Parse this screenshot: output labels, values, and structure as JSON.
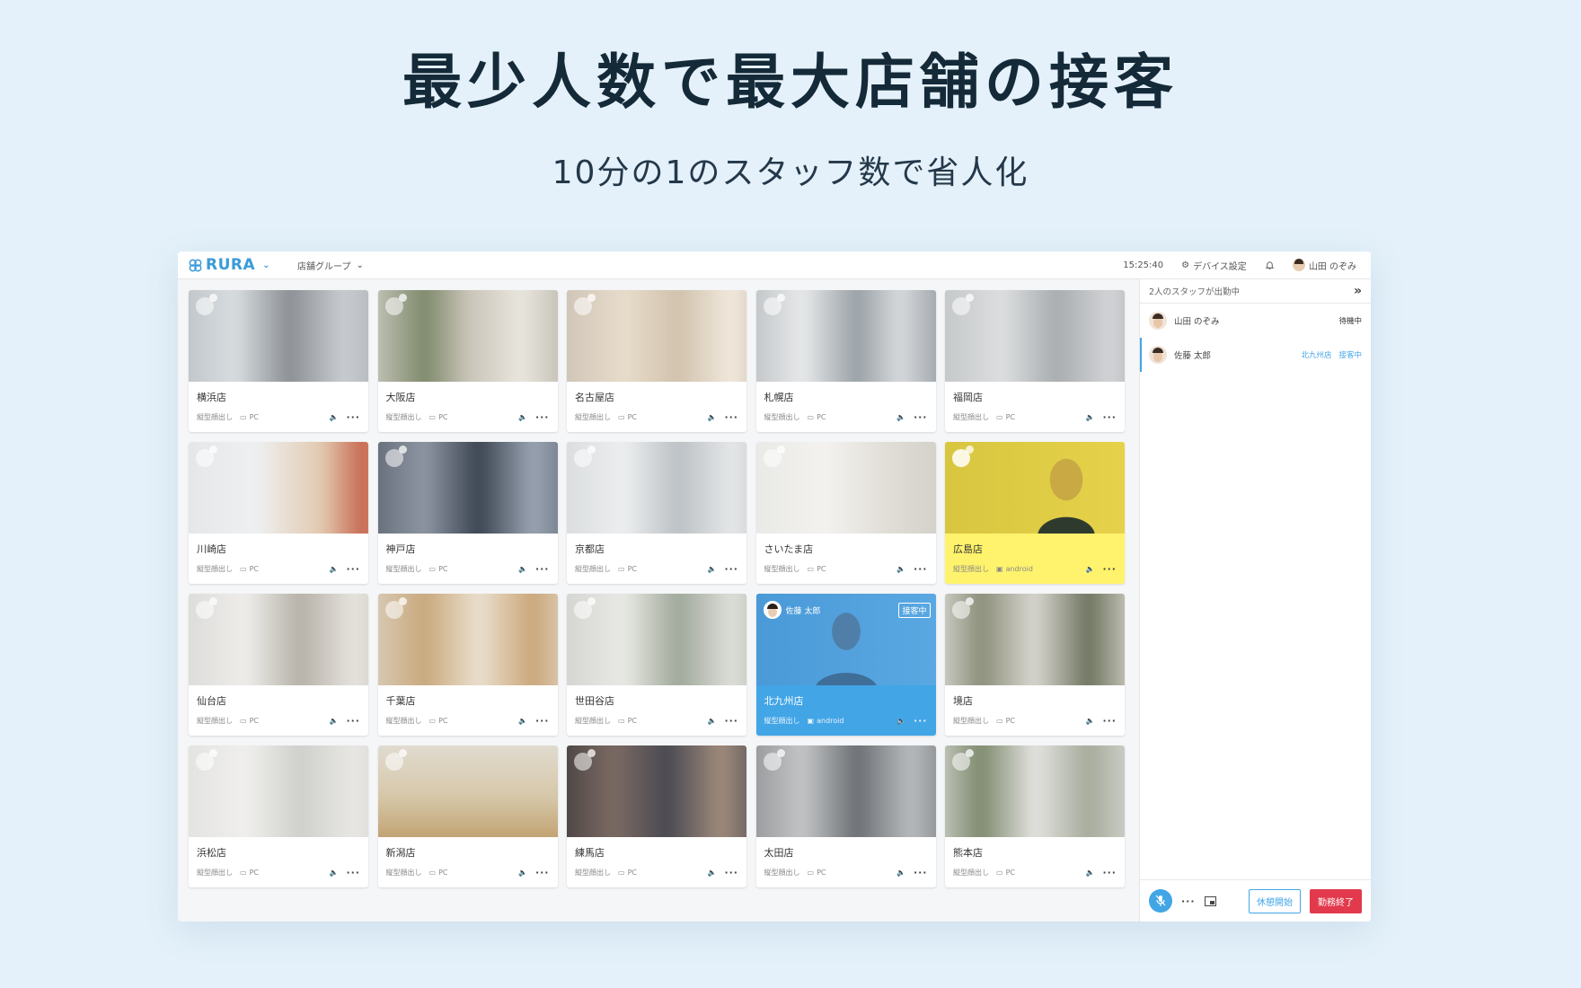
{
  "hero": {
    "title": "最少人数で最大店舗の接客",
    "subtitle": "10分の1のスタッフ数で省人化"
  },
  "topbar": {
    "logo": "RURA",
    "group_select": "店舗グループ",
    "time": "15:25:40",
    "device_settings": "デバイス設定",
    "user_name": "山田 のぞみ"
  },
  "stores": [
    {
      "name": "横浜店",
      "mode": "縦型顔出し",
      "device": "PC"
    },
    {
      "name": "大阪店",
      "mode": "縦型顔出し",
      "device": "PC"
    },
    {
      "name": "名古屋店",
      "mode": "縦型顔出し",
      "device": "PC"
    },
    {
      "name": "札幌店",
      "mode": "縦型顔出し",
      "device": "PC"
    },
    {
      "name": "福岡店",
      "mode": "縦型顔出し",
      "device": "PC"
    },
    {
      "name": "川崎店",
      "mode": "縦型顔出し",
      "device": "PC"
    },
    {
      "name": "神戸店",
      "mode": "縦型顔出し",
      "device": "PC"
    },
    {
      "name": "京都店",
      "mode": "縦型顔出し",
      "device": "PC"
    },
    {
      "name": "さいたま店",
      "mode": "縦型顔出し",
      "device": "PC"
    },
    {
      "name": "広島店",
      "mode": "縦型顔出し",
      "device": "android"
    },
    {
      "name": "仙台店",
      "mode": "縦型顔出し",
      "device": "PC"
    },
    {
      "name": "千葉店",
      "mode": "縦型顔出し",
      "device": "PC"
    },
    {
      "name": "世田谷店",
      "mode": "縦型顔出し",
      "device": "PC"
    },
    {
      "name": "北九州店",
      "mode": "縦型顔出し",
      "device": "android",
      "staff": "佐藤 太郎",
      "badge": "接客中"
    },
    {
      "name": "境店",
      "mode": "縦型顔出し",
      "device": "PC"
    },
    {
      "name": "浜松店",
      "mode": "縦型顔出し",
      "device": "PC"
    },
    {
      "name": "新潟店",
      "mode": "縦型顔出し",
      "device": "PC"
    },
    {
      "name": "練馬店",
      "mode": "縦型顔出し",
      "device": "PC"
    },
    {
      "name": "太田店",
      "mode": "縦型顔出し",
      "device": "PC"
    },
    {
      "name": "熊本店",
      "mode": "縦型顔出し",
      "device": "PC"
    }
  ],
  "panel": {
    "header": "2人のスタッフが出勤中",
    "staff": [
      {
        "name": "山田 のぞみ",
        "status": "待機中"
      },
      {
        "name": "佐藤 太郎",
        "location": "北九州店",
        "status": "接客中"
      }
    ],
    "break_button": "休憩開始",
    "end_button": "勤務終了"
  },
  "colors": {
    "accent": "#42a5e6",
    "active_store": "#fff36d",
    "end_button": "#e23a4c",
    "background": "#e4f1fa"
  }
}
